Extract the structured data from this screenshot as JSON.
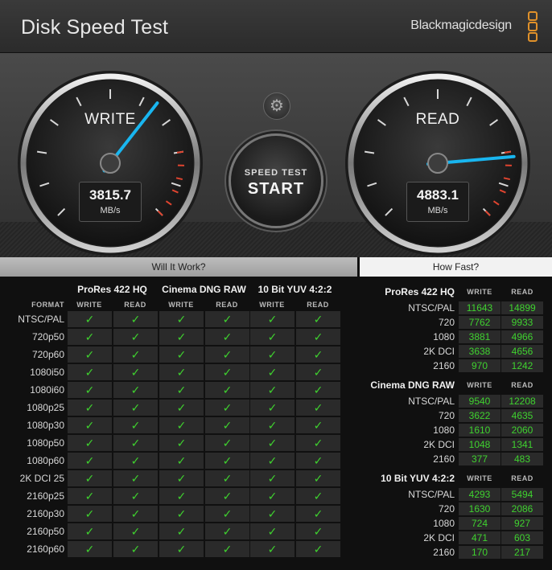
{
  "window": {
    "title": "Disk Speed Test",
    "brand": "Blackmagicdesign"
  },
  "colors": {
    "accent_needle": "#19b6f0",
    "check_green": "#3fd22f",
    "redline": "#e0442f"
  },
  "gauges": {
    "write": {
      "label": "WRITE",
      "value": "3815.7",
      "unit": "MB/s"
    },
    "read": {
      "label": "READ",
      "value": "4883.1",
      "unit": "MB/s"
    }
  },
  "controls": {
    "settings_icon": "gear-icon",
    "start_small": "SPEED TEST",
    "start_big": "START"
  },
  "tabs": {
    "will_it_work": "Will It Work?",
    "how_fast": "How Fast?"
  },
  "will_it_work": {
    "format_header": "FORMAT",
    "codecs": [
      "ProRes 422 HQ",
      "Cinema DNG RAW",
      "10 Bit YUV 4:2:2"
    ],
    "sub_headers": [
      "WRITE",
      "READ"
    ],
    "check_glyph": "✓",
    "rows": [
      "NTSC/PAL",
      "720p50",
      "720p60",
      "1080i50",
      "1080i60",
      "1080p25",
      "1080p30",
      "1080p50",
      "1080p60",
      "2K DCI 25",
      "2160p25",
      "2160p30",
      "2160p50",
      "2160p60"
    ]
  },
  "how_fast": {
    "col_write": "WRITE",
    "col_read": "READ",
    "groups": [
      {
        "name": "ProRes 422 HQ",
        "rows": [
          {
            "format": "NTSC/PAL",
            "write": "11643",
            "read": "14899"
          },
          {
            "format": "720",
            "write": "7762",
            "read": "9933"
          },
          {
            "format": "1080",
            "write": "3881",
            "read": "4966"
          },
          {
            "format": "2K DCI",
            "write": "3638",
            "read": "4656"
          },
          {
            "format": "2160",
            "write": "970",
            "read": "1242"
          }
        ]
      },
      {
        "name": "Cinema DNG RAW",
        "rows": [
          {
            "format": "NTSC/PAL",
            "write": "9540",
            "read": "12208"
          },
          {
            "format": "720",
            "write": "3622",
            "read": "4635"
          },
          {
            "format": "1080",
            "write": "1610",
            "read": "2060"
          },
          {
            "format": "2K DCI",
            "write": "1048",
            "read": "1341"
          },
          {
            "format": "2160",
            "write": "377",
            "read": "483"
          }
        ]
      },
      {
        "name": "10 Bit YUV 4:2:2",
        "rows": [
          {
            "format": "NTSC/PAL",
            "write": "4293",
            "read": "5494"
          },
          {
            "format": "720",
            "write": "1630",
            "read": "2086"
          },
          {
            "format": "1080",
            "write": "724",
            "read": "927"
          },
          {
            "format": "2K DCI",
            "write": "471",
            "read": "603"
          },
          {
            "format": "2160",
            "write": "170",
            "read": "217"
          }
        ]
      }
    ]
  }
}
